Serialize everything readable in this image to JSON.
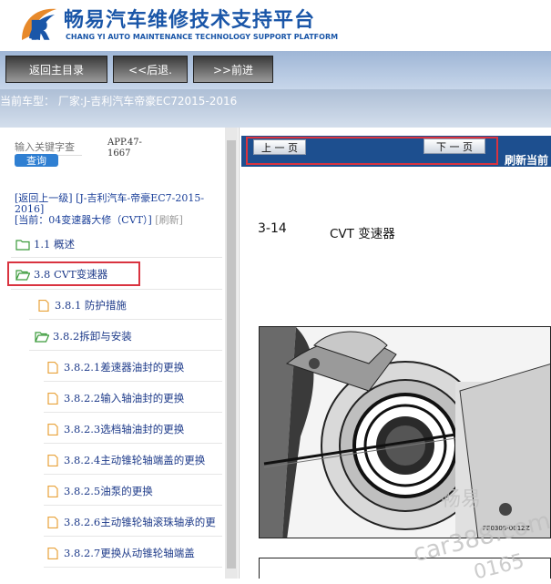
{
  "header": {
    "title_cn": "畅易汽车维修技术支持平台",
    "title_en": "CHANG YI AUTO MAINTENANCE TECHNOLOGY SUPPORT PLATFORM"
  },
  "toolbar": {
    "home": "返回主目录",
    "back": "<<后退.",
    "forward": ">>前进"
  },
  "car_bar": {
    "text": "当前车型：  厂家:J-吉利汽车帝豪EC72015-2016"
  },
  "search": {
    "placeholder": "输入关键字查",
    "button": "查询"
  },
  "app_version": "APP.47-1667",
  "breadcrumb": {
    "up": "[返回上一级]",
    "path": "[J-吉利汽车-帝豪EC7-2015-2016]",
    "current_label": "[当前：",
    "current_code": "04",
    "current_name": "变速器大修（CVT）]",
    "refresh": "[刷新]"
  },
  "tree": [
    {
      "label": "1.1 概述",
      "type": "folder"
    },
    {
      "label": "3.8 CVT变速器",
      "type": "folder-open"
    },
    {
      "label": "3.8.1 防护措施",
      "type": "doc"
    },
    {
      "label": "3.8.2拆卸与安装",
      "type": "folder-open"
    },
    {
      "label": "3.8.2.1差速器油封的更换",
      "type": "doc"
    },
    {
      "label": "3.8.2.2输入轴油封的更换",
      "type": "doc"
    },
    {
      "label": "3.8.2.3选档轴油封的更换",
      "type": "doc"
    },
    {
      "label": "3.8.2.4主动锥轮轴端盖的更换",
      "type": "doc"
    },
    {
      "label": "3.8.2.5油泵的更换",
      "type": "doc"
    },
    {
      "label": "3.8.2.6主动锥轮轴滚珠轴承的更",
      "type": "doc"
    },
    {
      "label": "3.8.2.7更换从动锥轮轴端盖",
      "type": "doc"
    }
  ],
  "viewer": {
    "prev_page": "上 一 页",
    "next_page": "下 一 页",
    "refresh_current": "刷新当前"
  },
  "document": {
    "page_number": "3-14",
    "page_title": "CVT 变速器",
    "figure_code": "FE0308-001ZZ"
  },
  "watermark": {
    "line1": "畅易",
    "line2": "car388.com",
    "line3": "0165"
  },
  "colors": {
    "brand_blue": "#1a56a8",
    "viewer_bar": "#1d4f8f",
    "highlight_red": "#d9333f",
    "tree_text": "#1e3b8a"
  }
}
